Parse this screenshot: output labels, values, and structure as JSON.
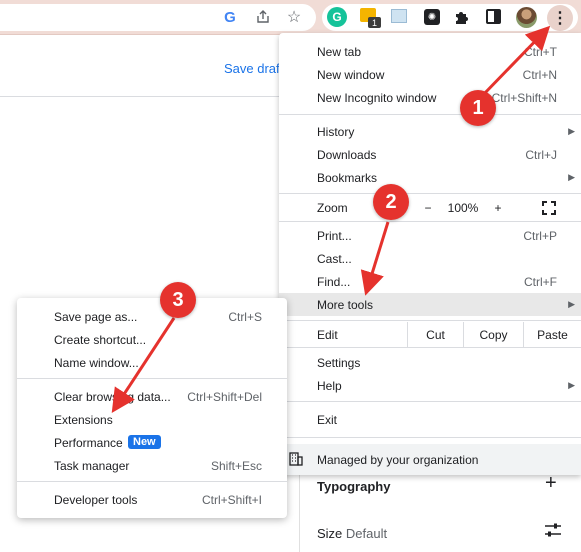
{
  "toolbar": {
    "google_glyph": "G",
    "grammarly_glyph": "G",
    "ext_badge": "1",
    "icons": [
      "google-lens-icon",
      "share-icon",
      "star-icon",
      "grammarly-extension-icon",
      "extension-icon",
      "extension-icon",
      "openai-extension-icon",
      "puzzle-icon",
      "side-panel-icon",
      "avatar",
      "kebab-menu-icon"
    ]
  },
  "page": {
    "save_draft": "Save draft",
    "typography": "Typography",
    "size_label": "Size",
    "size_value": "Default"
  },
  "main_menu": {
    "new_tab": {
      "label": "New tab",
      "shortcut": "Ctrl+T"
    },
    "new_window": {
      "label": "New window",
      "shortcut": "Ctrl+N"
    },
    "new_incognito": {
      "label": "New Incognito window",
      "shortcut": "Ctrl+Shift+N"
    },
    "history": {
      "label": "History"
    },
    "downloads": {
      "label": "Downloads",
      "shortcut": "Ctrl+J"
    },
    "bookmarks": {
      "label": "Bookmarks"
    },
    "zoom": {
      "label": "Zoom",
      "minus": "−",
      "value": "100%",
      "plus": "+"
    },
    "print": {
      "label": "Print...",
      "shortcut": "Ctrl+P"
    },
    "cast": {
      "label": "Cast..."
    },
    "find": {
      "label": "Find...",
      "shortcut": "Ctrl+F"
    },
    "more_tools": {
      "label": "More tools"
    },
    "edit": {
      "label": "Edit",
      "cut": "Cut",
      "copy": "Copy",
      "paste": "Paste"
    },
    "settings": {
      "label": "Settings"
    },
    "help": {
      "label": "Help"
    },
    "exit": {
      "label": "Exit"
    },
    "managed": {
      "label": "Managed by your organization"
    }
  },
  "sub_menu": {
    "save_page": {
      "label": "Save page as...",
      "shortcut": "Ctrl+S"
    },
    "create_shortcut": {
      "label": "Create shortcut..."
    },
    "name_window": {
      "label": "Name window..."
    },
    "clear_data": {
      "label": "Clear browsing data...",
      "shortcut": "Ctrl+Shift+Del"
    },
    "extensions": {
      "label": "Extensions"
    },
    "performance": {
      "label": "Performance",
      "badge": "New"
    },
    "task_manager": {
      "label": "Task manager",
      "shortcut": "Shift+Esc"
    },
    "developer_tools": {
      "label": "Developer tools",
      "shortcut": "Ctrl+Shift+I"
    }
  },
  "annotations": {
    "step1": "1",
    "step2": "2",
    "step3": "3",
    "color": "#e5322d"
  }
}
